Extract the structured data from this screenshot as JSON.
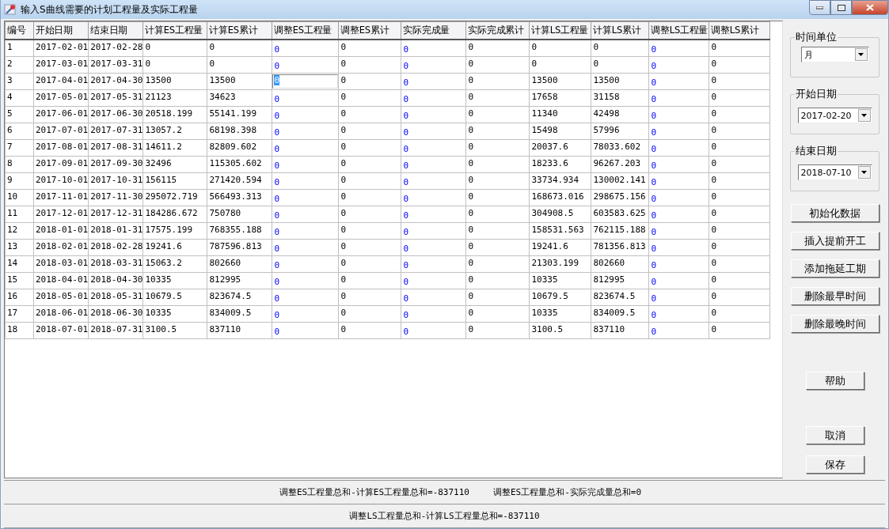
{
  "window": {
    "title": "输入S曲线需要的计划工程量及实际工程量"
  },
  "table": {
    "columns": [
      {
        "label": "编号",
        "kind": "computed"
      },
      {
        "label": "开始日期",
        "kind": "computed"
      },
      {
        "label": "结束日期",
        "kind": "computed"
      },
      {
        "label": "计算ES工程量",
        "kind": "computed"
      },
      {
        "label": "计算ES累计",
        "kind": "computed"
      },
      {
        "label": "调整ES工程量",
        "kind": "editable"
      },
      {
        "label": "调整ES累计",
        "kind": "computed"
      },
      {
        "label": "实际完成量",
        "kind": "editable"
      },
      {
        "label": "实际完成累计",
        "kind": "computed"
      },
      {
        "label": "计算LS工程量",
        "kind": "computed"
      },
      {
        "label": "计算LS累计",
        "kind": "computed"
      },
      {
        "label": "调整LS工程量",
        "kind": "editable"
      },
      {
        "label": "调整LS累计",
        "kind": "computed"
      }
    ],
    "rows": [
      {
        "selected": false,
        "cells": [
          "1",
          "2017-02-01",
          "2017-02-28",
          "0",
          "0",
          "0",
          "0",
          "0",
          "0",
          "0",
          "0",
          "0",
          "0"
        ]
      },
      {
        "selected": false,
        "cells": [
          "2",
          "2017-03-01",
          "2017-03-31",
          "0",
          "0",
          "0",
          "0",
          "0",
          "0",
          "0",
          "0",
          "0",
          "0"
        ]
      },
      {
        "selected": true,
        "cells": [
          "3",
          "2017-04-01",
          "2017-04-30",
          "13500",
          "13500",
          "0",
          "0",
          "0",
          "0",
          "13500",
          "13500",
          "0",
          "0"
        ]
      },
      {
        "selected": false,
        "cells": [
          "4",
          "2017-05-01",
          "2017-05-31",
          "21123",
          "34623",
          "0",
          "0",
          "0",
          "0",
          "17658",
          "31158",
          "0",
          "0"
        ]
      },
      {
        "selected": false,
        "cells": [
          "5",
          "2017-06-01",
          "2017-06-30",
          "20518.199",
          "55141.199",
          "0",
          "0",
          "0",
          "0",
          "11340",
          "42498",
          "0",
          "0"
        ]
      },
      {
        "selected": false,
        "cells": [
          "6",
          "2017-07-01",
          "2017-07-31",
          "13057.2",
          "68198.398",
          "0",
          "0",
          "0",
          "0",
          "15498",
          "57996",
          "0",
          "0"
        ]
      },
      {
        "selected": false,
        "cells": [
          "7",
          "2017-08-01",
          "2017-08-31",
          "14611.2",
          "82809.602",
          "0",
          "0",
          "0",
          "0",
          "20037.6",
          "78033.602",
          "0",
          "0"
        ]
      },
      {
        "selected": false,
        "cells": [
          "8",
          "2017-09-01",
          "2017-09-30",
          "32496",
          "115305.602",
          "0",
          "0",
          "0",
          "0",
          "18233.6",
          "96267.203",
          "0",
          "0"
        ]
      },
      {
        "selected": false,
        "cells": [
          "9",
          "2017-10-01",
          "2017-10-31",
          "156115",
          "271420.594",
          "0",
          "0",
          "0",
          "0",
          "33734.934",
          "130002.141",
          "0",
          "0"
        ]
      },
      {
        "selected": false,
        "cells": [
          "10",
          "2017-11-01",
          "2017-11-30",
          "295072.719",
          "566493.313",
          "0",
          "0",
          "0",
          "0",
          "168673.016",
          "298675.156",
          "0",
          "0"
        ]
      },
      {
        "selected": false,
        "cells": [
          "11",
          "2017-12-01",
          "2017-12-31",
          "184286.672",
          "750780",
          "0",
          "0",
          "0",
          "0",
          "304908.5",
          "603583.625",
          "0",
          "0"
        ]
      },
      {
        "selected": false,
        "cells": [
          "12",
          "2018-01-01",
          "2018-01-31",
          "17575.199",
          "768355.188",
          "0",
          "0",
          "0",
          "0",
          "158531.563",
          "762115.188",
          "0",
          "0"
        ]
      },
      {
        "selected": false,
        "cells": [
          "13",
          "2018-02-01",
          "2018-02-28",
          "19241.6",
          "787596.813",
          "0",
          "0",
          "0",
          "0",
          "19241.6",
          "781356.813",
          "0",
          "0"
        ]
      },
      {
        "selected": false,
        "cells": [
          "14",
          "2018-03-01",
          "2018-03-31",
          "15063.2",
          "802660",
          "0",
          "0",
          "0",
          "0",
          "21303.199",
          "802660",
          "0",
          "0"
        ]
      },
      {
        "selected": false,
        "cells": [
          "15",
          "2018-04-01",
          "2018-04-30",
          "10335",
          "812995",
          "0",
          "0",
          "0",
          "0",
          "10335",
          "812995",
          "0",
          "0"
        ]
      },
      {
        "selected": false,
        "cells": [
          "16",
          "2018-05-01",
          "2018-05-31",
          "10679.5",
          "823674.5",
          "0",
          "0",
          "0",
          "0",
          "10679.5",
          "823674.5",
          "0",
          "0"
        ]
      },
      {
        "selected": false,
        "cells": [
          "17",
          "2018-06-01",
          "2018-06-30",
          "10335",
          "834009.5",
          "0",
          "0",
          "0",
          "0",
          "10335",
          "834009.5",
          "0",
          "0"
        ]
      },
      {
        "selected": false,
        "cells": [
          "18",
          "2018-07-01",
          "2018-07-31",
          "3100.5",
          "837110",
          "0",
          "0",
          "0",
          "0",
          "3100.5",
          "837110",
          "0",
          "0"
        ]
      }
    ]
  },
  "side_panel": {
    "groups": [
      {
        "title": "时间单位",
        "value": "月"
      },
      {
        "title": "开始日期",
        "value": "2017-02-20"
      },
      {
        "title": "结束日期",
        "value": "2018-07-10"
      }
    ],
    "actions": [
      "初始化数据",
      "插入提前开工",
      "添加拖延工期",
      "删除最早时间",
      "删除最晚时间"
    ],
    "help": "帮助",
    "cancel": "取消",
    "save": "保存"
  },
  "status_bar": {
    "lines": [
      [
        "调整ES工程量总和-计算ES工程量总和=-837110",
        "调整ES工程量总和-实际完成量总和=0"
      ],
      [
        "调整LS工程量总和-计算LS工程量总和=-837110"
      ]
    ]
  }
}
